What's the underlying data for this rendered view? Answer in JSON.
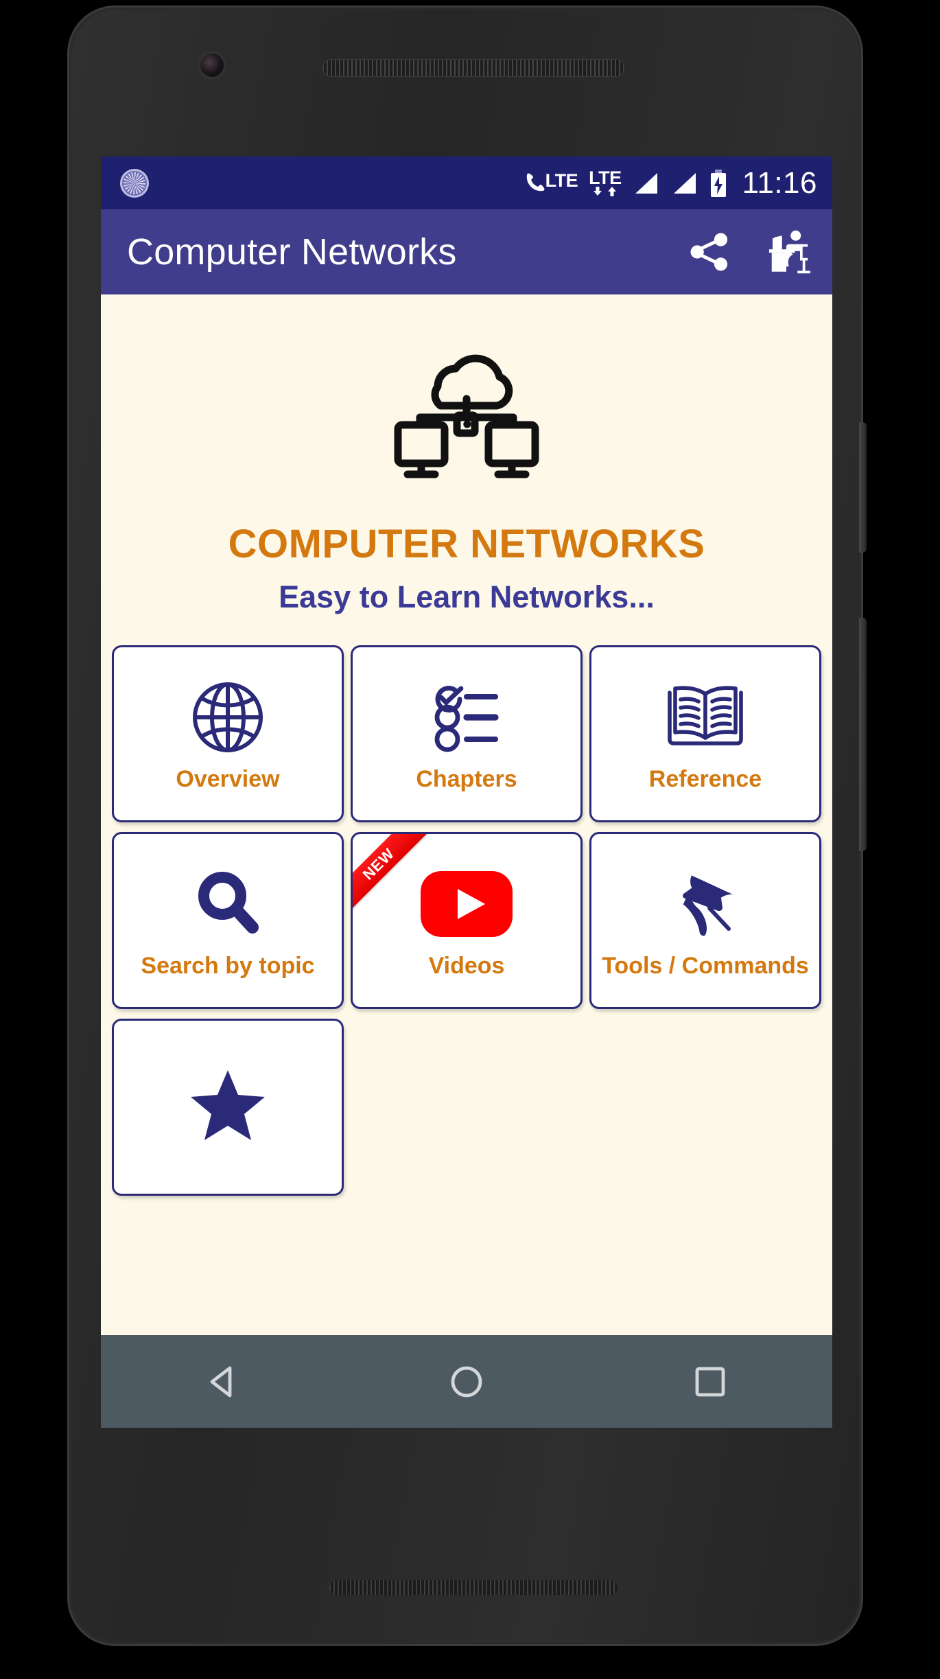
{
  "status_bar": {
    "volte_label": "LTE",
    "lte_label": "LTE",
    "time": "11:16",
    "icons": [
      "volte-icon",
      "lte-data-icon",
      "signal-bars-sim1-icon",
      "signal-bars-sim2-icon",
      "battery-charging-icon"
    ],
    "background_color": "#1F2070"
  },
  "app_bar": {
    "title": "Computer Networks",
    "background_color": "#3F3D8C",
    "actions": [
      {
        "name": "share-icon",
        "label": "Share"
      },
      {
        "name": "study-desk-icon",
        "label": "Study"
      }
    ]
  },
  "hero": {
    "logo_icon": "cloud-network-icon",
    "title": "COMPUTER NETWORKS",
    "subtitle": "Easy to Learn Networks...",
    "title_color": "#D3790F",
    "subtitle_color": "#3B3A96",
    "background_color": "#FDF8E8"
  },
  "tiles": [
    {
      "label": "Overview",
      "icon": "globe-icon",
      "badge": ""
    },
    {
      "label": "Chapters",
      "icon": "checklist-icon",
      "badge": ""
    },
    {
      "label": "Reference",
      "icon": "open-book-icon",
      "badge": ""
    },
    {
      "label": "Search by topic",
      "icon": "search-icon",
      "badge": ""
    },
    {
      "label": "Videos",
      "icon": "youtube-play-icon",
      "badge": "NEW"
    },
    {
      "label": "Tools / Commands",
      "icon": "pushpin-icon",
      "badge": ""
    },
    {
      "label": "",
      "icon": "star-icon",
      "badge": ""
    }
  ],
  "nav_bar": {
    "background_color": "#4E5A61",
    "buttons": [
      {
        "name": "back-button",
        "label": "Back"
      },
      {
        "name": "home-button",
        "label": "Home"
      },
      {
        "name": "recents-button",
        "label": "Recents"
      }
    ]
  },
  "theme": {
    "accent_orange": "#D3790F",
    "accent_navy": "#2A2A78",
    "tile_background": "#FFFFFF",
    "page_background": "#FDF8E8",
    "badge_red": "#E00000"
  }
}
